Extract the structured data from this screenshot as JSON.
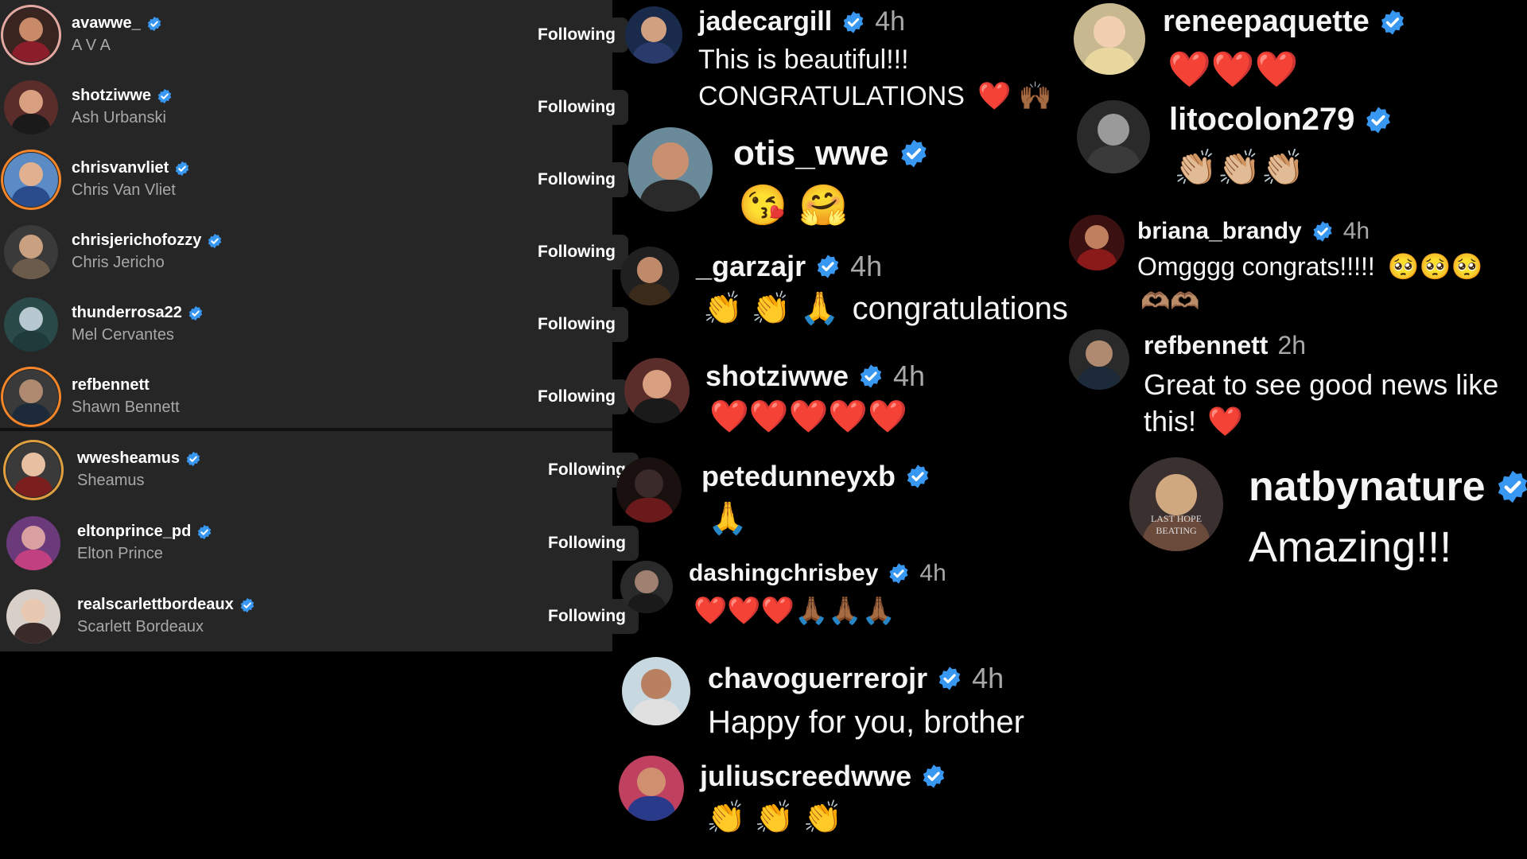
{
  "following": {
    "button_label": "Following",
    "items": [
      {
        "username": "avawwe_",
        "name": "A V A",
        "verified": true
      },
      {
        "username": "shotziwwe",
        "name": "Ash Urbanski",
        "verified": true
      },
      {
        "username": "chrisvanvliet",
        "name": "Chris Van Vliet",
        "verified": true
      },
      {
        "username": "chrisjerichofozzy",
        "name": "Chris Jericho",
        "verified": true
      },
      {
        "username": "thunderrosa22",
        "name": "Mel Cervantes",
        "verified": true
      },
      {
        "username": "refbennett",
        "name": "Shawn Bennett",
        "verified": false
      },
      {
        "username": "wwesheamus",
        "name": "Sheamus",
        "verified": true
      },
      {
        "username": "eltonprince_pd",
        "name": "Elton Prince",
        "verified": true
      },
      {
        "username": "realscarlettbordeaux",
        "name": "Scarlett Bordeaux",
        "verified": true
      }
    ]
  },
  "comments_mid": [
    {
      "username": "jadecargill",
      "time": "4h",
      "line1": "This is beautiful!!!",
      "line2": "CONGRATULATIONS",
      "emoji": "❤️ 🙌🏾"
    },
    {
      "username": "otis_wwe",
      "time": "",
      "emoji": "😘 🤗"
    },
    {
      "username": "_garzajr",
      "time": "4h",
      "emoji": "👏 👏 🙏",
      "text": "congratulations"
    },
    {
      "username": "shotziwwe",
      "time": "4h",
      "emoji": "❤️❤️❤️❤️❤️"
    },
    {
      "username": "petedunneyxb",
      "time": "",
      "emoji": "🙏"
    },
    {
      "username": "dashingchrisbey",
      "time": "4h",
      "emoji": "❤️❤️❤️🙏🏾🙏🏾🙏🏾"
    },
    {
      "username": "chavoguerrerojr",
      "time": "4h",
      "text": "Happy for you, brother"
    },
    {
      "username": "juliuscreedwwe",
      "time": "",
      "emoji": "👏 👏 👏"
    }
  ],
  "comments_right": [
    {
      "username": "reneepaquette",
      "emoji": "❤️❤️❤️"
    },
    {
      "username": "litocolon279",
      "emoji": "👏🏼👏🏼👏🏼"
    },
    {
      "username": "briana_brandy",
      "time": "4h",
      "text": "Omgggg congrats!!!!!",
      "emoji": "🥺🥺🥺",
      "emoji2": "🫶🏽🫶🏽"
    },
    {
      "username": "refbennett",
      "time": "2h",
      "text": "Great to see good news like",
      "text2": "this!",
      "emoji": "❤️"
    },
    {
      "username": "natbynature",
      "text": "Amazing!!!",
      "avatar_text": "LAST HOPE BEATING"
    }
  ],
  "colors": {
    "verified": "#3897f0",
    "heart": "#ff2d55",
    "panel": "#262626",
    "secondary_text": "#a8a8a8"
  }
}
